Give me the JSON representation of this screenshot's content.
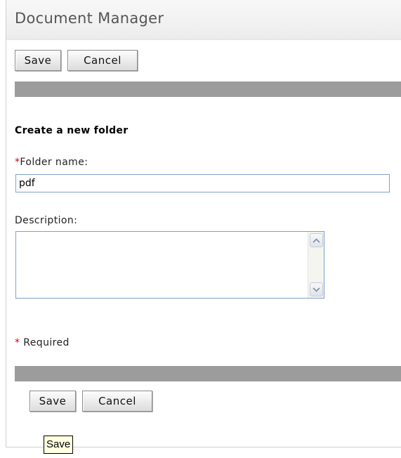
{
  "header": {
    "title": "Document Manager"
  },
  "toolbar_top": {
    "save_label": "Save",
    "cancel_label": "Cancel"
  },
  "form": {
    "heading": "Create a new folder",
    "required_mark": "*",
    "folder_name_label": "Folder name:",
    "folder_name_value": "pdf",
    "description_label": "Description:",
    "description_value": "",
    "required_note": "Required"
  },
  "toolbar_bottom": {
    "save_label": "Save",
    "cancel_label": "Cancel"
  },
  "tooltip": {
    "text": "Save"
  },
  "icons": {
    "scroll_up": "scroll-up-arrow-icon",
    "scroll_down": "scroll-down-arrow-icon"
  },
  "colors": {
    "required_star": "#e00000",
    "section_bar": "#9c9c9c",
    "tooltip_bg": "#ffffe1"
  }
}
